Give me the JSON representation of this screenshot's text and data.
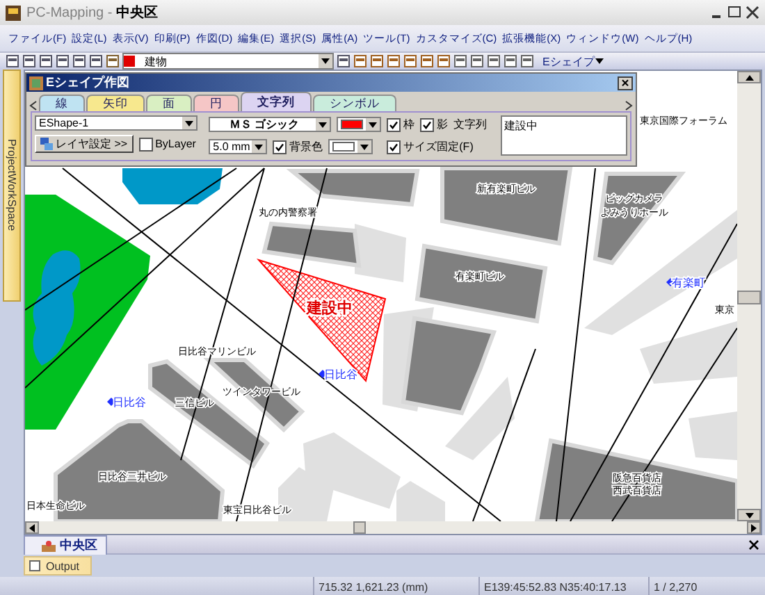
{
  "window": {
    "title": "PC-Mapping - **中央区**"
  },
  "menu": [
    "ファイル(F)",
    "設定(L)",
    "表示(V)",
    "印刷(P)",
    "作図(D)",
    "編集(E)",
    "選択(S)",
    "属性(A)",
    "ツール(T)",
    "カスタマイズ(C)",
    "拡張機能(X)",
    "ウィンドウ(W)",
    "ヘルプ(H)"
  ],
  "toolbar": {
    "layer_select": "建物",
    "eshape_button": "Eシェイプ"
  },
  "sidebar": {
    "label": "ProjectWorkSpace"
  },
  "dialog": {
    "title": "Eシェイプ作図",
    "tabs": [
      {
        "label": "線",
        "selected": false,
        "color": "#bfe3f2"
      },
      {
        "label": "矢印",
        "selected": false,
        "color": "#f7e88e"
      },
      {
        "label": "面",
        "selected": false,
        "color": "#d9efc2"
      },
      {
        "label": "円",
        "selected": false,
        "color": "#f5c6c6"
      },
      {
        "label": "文字列",
        "selected": true,
        "color": "#dcd4f2"
      },
      {
        "label": "シンボル",
        "selected": false,
        "color": "#c9ecdc"
      }
    ],
    "shape_select": "EShape-1",
    "font": {
      "label": "ＭＳ ゴシック",
      "color": "#ff0000"
    },
    "layer_button": "レイヤ設定 >>",
    "bylayer": {
      "label": "ByLayer",
      "checked": false
    },
    "size_select": "5.0 mm",
    "frame": {
      "label": "枠",
      "checked": true
    },
    "shadow": {
      "label": "影",
      "checked": true
    },
    "background": {
      "label": "背景色",
      "checked": true,
      "color": "#ffffff"
    },
    "fixed_size": {
      "label": "サイズ固定(F)",
      "checked": true
    },
    "text_label": "文字列",
    "text_value": "建設中"
  },
  "map": {
    "labels": [
      {
        "kind": "building",
        "text": "東京国際フォーラム"
      },
      {
        "kind": "building",
        "text": "新有楽町ビル"
      },
      {
        "kind": "building",
        "text": "ビッグカメラ"
      },
      {
        "kind": "building",
        "text": "丸の内警察署"
      },
      {
        "kind": "building",
        "text": "よみうりホール"
      },
      {
        "kind": "building",
        "text": "有楽町ビル"
      },
      {
        "kind": "station",
        "text": "有楽町"
      },
      {
        "kind": "construction",
        "text": "建設中"
      },
      {
        "kind": "building",
        "text": "東京"
      },
      {
        "kind": "building",
        "text": "日比谷マリンビル"
      },
      {
        "kind": "station",
        "text": "日比谷"
      },
      {
        "kind": "building",
        "text": "ツインタワービル"
      },
      {
        "kind": "station",
        "text": "日比谷"
      },
      {
        "kind": "building",
        "text": "三信ビル"
      },
      {
        "kind": "building",
        "text": "日比谷三井ビル"
      },
      {
        "kind": "building",
        "text": "阪急百貨店"
      },
      {
        "kind": "building",
        "text": "西武百貨店"
      },
      {
        "kind": "building",
        "text": "日本生命ビル"
      },
      {
        "kind": "building",
        "text": "東宝日比谷ビル"
      }
    ]
  },
  "doc_tabs": [
    {
      "label": "中央区",
      "selected": true
    }
  ],
  "output_tab": {
    "label": "Output"
  },
  "status_bar": {
    "coords": "715.32 1,621.23 (mm)",
    "latlon": "E139:45:52.83 N35:40:17.13",
    "scale": "1 / 2,270"
  }
}
